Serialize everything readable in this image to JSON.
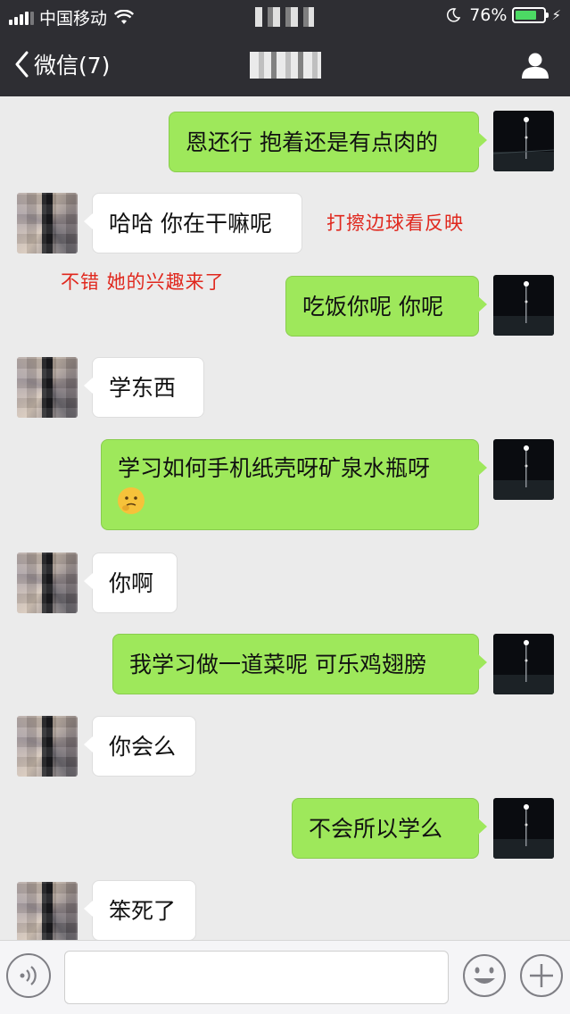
{
  "status_bar": {
    "carrier": "中国移动",
    "battery_percent": "76%",
    "battery_level": 0.76
  },
  "nav": {
    "back_label": "微信(7)"
  },
  "messages": [
    {
      "sender": "me",
      "text": "恩还行 抱着还是有点肉的"
    },
    {
      "sender": "other",
      "text": "哈哈 你在干嘛呢"
    },
    {
      "sender": "me",
      "text": "吃饭你呢 你呢"
    },
    {
      "sender": "other",
      "text": "学东西"
    },
    {
      "sender": "me",
      "text": "学习如何手机纸壳呀矿泉水瓶呀",
      "emoji": "thinking-face-icon"
    },
    {
      "sender": "other",
      "text": "你啊"
    },
    {
      "sender": "me",
      "text": "我学习做一道菜呢 可乐鸡翅膀"
    },
    {
      "sender": "other",
      "text": "你会么"
    },
    {
      "sender": "me",
      "text": "不会所以学么"
    },
    {
      "sender": "other",
      "text": "笨死了"
    }
  ],
  "annotations": [
    "打擦边球看反映",
    "不错 她的兴趣来了"
  ],
  "input": {
    "value": ""
  },
  "colors": {
    "bar_background": "#2e2e33",
    "chat_background": "#ebebeb",
    "my_bubble": "#9ee85b",
    "other_bubble": "#ffffff",
    "annotation": "#e0281e"
  },
  "icons": [
    "signal-icon",
    "wifi-icon",
    "moon-icon",
    "battery-icon",
    "back-chevron-icon",
    "profile-icon",
    "voice-icon",
    "emoji-icon",
    "plus-icon"
  ]
}
